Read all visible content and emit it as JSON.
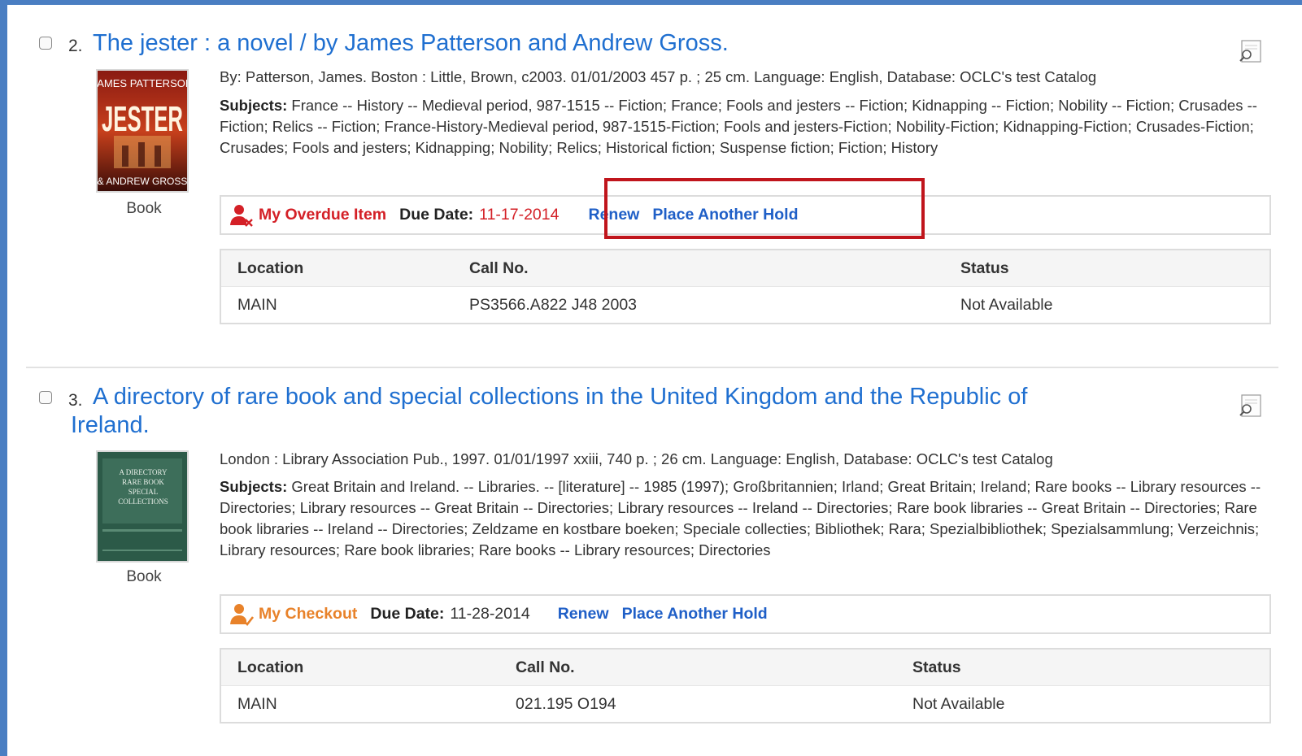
{
  "records": [
    {
      "number": "2.",
      "title": "The jester : a novel / by James Patterson and Andrew Gross.",
      "format": "Book",
      "cover_text": {
        "top": "JAMES PATTERSON",
        "main": "JESTER",
        "bottom": "& ANDREW GROSS"
      },
      "meta": "By: Patterson, James. Boston : Little, Brown, c2003. 01/01/2003 457 p. ; 25 cm. Language: English, Database: OCLC's test Catalog",
      "subjects_label": "Subjects:",
      "subjects": "France -- History -- Medieval period, 987-1515 -- Fiction; France; Fools and jesters -- Fiction; Kidnapping -- Fiction; Nobility -- Fiction; Crusades -- Fiction; Relics -- Fiction; France-History-Medieval period, 987-1515-Fiction; Fools and jesters-Fiction; Nobility-Fiction; Kidnapping-Fiction; Crusades-Fiction; Crusades; Fools and jesters; Kidnapping; Nobility; Relics; Historical fiction; Suspense fiction; Fiction; History",
      "status": {
        "label": "My Overdue Item",
        "icon": "user-overdue-icon",
        "color": "#d42027",
        "due_label": "Due Date:",
        "due_date": "11-17-2014",
        "due_color": "#d42027",
        "renew": "Renew",
        "hold": "Place Another Hold"
      },
      "holdings": {
        "headers": [
          "Location",
          "Call No.",
          "Status"
        ],
        "rows": [
          [
            "MAIN",
            "PS3566.A822 J48 2003",
            "Not Available"
          ]
        ]
      }
    },
    {
      "number": "3.",
      "title_line1": "A directory of rare book and special collections in the United Kingdom and the Republic of",
      "title_line2": "Ireland.",
      "format": "Book",
      "cover_text": [
        "A DIRECTORY",
        "RARE BOOK",
        "SPECIAL",
        "COLLECTIONS"
      ],
      "meta": "London : Library Association Pub., 1997. 01/01/1997 xxiii, 740 p. ; 26 cm. Language: English, Database: OCLC's test Catalog",
      "subjects_label": "Subjects:",
      "subjects": "Great Britain and Ireland. -- Libraries. -- [literature] -- 1985 (1997); Großbritannien; Irland; Great Britain; Ireland; Rare books -- Library resources -- Directories; Library resources -- Great Britain -- Directories; Library resources -- Ireland -- Directories; Rare book libraries -- Great Britain -- Directories; Rare book libraries -- Ireland -- Directories; Zeldzame en kostbare boeken; Speciale collecties; Bibliothek; Rara; Spezialbibliothek; Spezialsammlung; Verzeichnis; Library resources; Rare book libraries; Rare books -- Library resources; Directories",
      "status": {
        "label": "My Checkout",
        "icon": "user-checkout-icon",
        "color": "#e8822a",
        "due_label": "Due Date:",
        "due_date": "11-28-2014",
        "due_color": "#333333",
        "renew": "Renew",
        "hold": "Place Another Hold"
      },
      "holdings": {
        "headers": [
          "Location",
          "Call No.",
          "Status"
        ],
        "rows": [
          [
            "MAIN",
            "021.195 O194",
            "Not Available"
          ]
        ]
      }
    }
  ],
  "colors": {
    "frame_border": "#4a7ec2",
    "link": "#1f6fd0",
    "highlight": "#c0151c"
  }
}
